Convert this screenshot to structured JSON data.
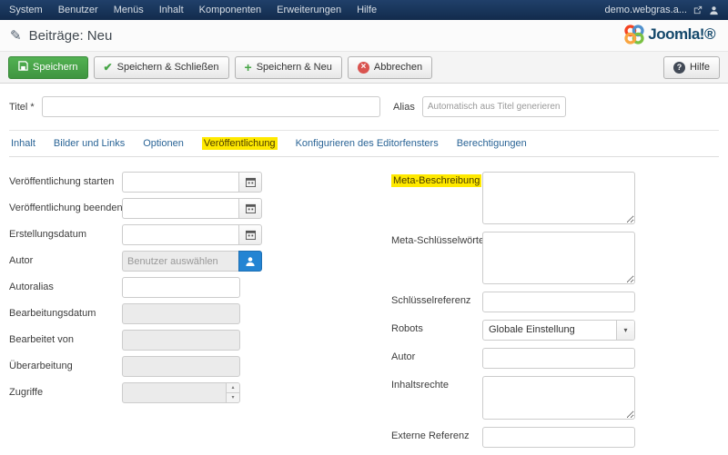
{
  "topnav": {
    "items": [
      "System",
      "Benutzer",
      "Menüs",
      "Inhalt",
      "Komponenten",
      "Erweiterungen",
      "Hilfe"
    ],
    "site_label": "demo.webgras.a..."
  },
  "header": {
    "page_title": "Beiträge: Neu",
    "logo_text": "Joomla!®"
  },
  "toolbar": {
    "save_label": "Speichern",
    "save_close_label": "Speichern & Schließen",
    "save_new_label": "Speichern & Neu",
    "cancel_label": "Abbrechen",
    "help_label": "Hilfe"
  },
  "title_row": {
    "title_label": "Titel *",
    "title_value": "",
    "alias_label": "Alias",
    "alias_value": "",
    "alias_placeholder": "Automatisch aus Titel generieren"
  },
  "tabs": [
    {
      "label": "Inhalt",
      "highlighted": false
    },
    {
      "label": "Bilder und Links",
      "highlighted": false
    },
    {
      "label": "Optionen",
      "highlighted": false
    },
    {
      "label": "Veröffentlichung",
      "highlighted": true
    },
    {
      "label": "Konfigurieren des Editorfensters",
      "highlighted": false
    },
    {
      "label": "Berechtigungen",
      "highlighted": false
    }
  ],
  "left_column": {
    "fields": [
      {
        "label": "Veröffentlichung starten",
        "type": "datetime",
        "value": ""
      },
      {
        "label": "Veröffentlichung beenden",
        "type": "datetime",
        "value": ""
      },
      {
        "label": "Erstellungsdatum",
        "type": "datetime",
        "value": ""
      },
      {
        "label": "Autor",
        "type": "user",
        "value": "",
        "placeholder": "Benutzer auswählen"
      },
      {
        "label": "Autoralias",
        "type": "text",
        "value": ""
      },
      {
        "label": "Bearbeitungsdatum",
        "type": "text-disabled",
        "value": ""
      },
      {
        "label": "Bearbeitet von",
        "type": "text-disabled",
        "value": ""
      },
      {
        "label": "Überarbeitung",
        "type": "text-disabled",
        "value": ""
      },
      {
        "label": "Zugriffe",
        "type": "number-disabled",
        "value": ""
      }
    ]
  },
  "right_column": {
    "fields": [
      {
        "label": "Meta-Beschreibung",
        "type": "textarea",
        "value": "",
        "highlighted": true
      },
      {
        "label": "Meta-Schlüsselwörter",
        "type": "textarea",
        "value": ""
      },
      {
        "label": "Schlüsselreferenz",
        "type": "text",
        "value": ""
      },
      {
        "label": "Robots",
        "type": "select",
        "value": "Globale Einstellung"
      },
      {
        "label": "Autor",
        "type": "text",
        "value": ""
      },
      {
        "label": "Inhaltsrechte",
        "type": "textarea",
        "value": ""
      },
      {
        "label": "Externe Referenz",
        "type": "text",
        "value": ""
      }
    ]
  },
  "colors": {
    "topbar_navy": "#16335a",
    "save_green": "#46a546",
    "link_blue": "#2a6496",
    "primary_blue": "#2384d3",
    "cancel_red": "#d9534f",
    "highlight_yellow": "#ffe900"
  }
}
